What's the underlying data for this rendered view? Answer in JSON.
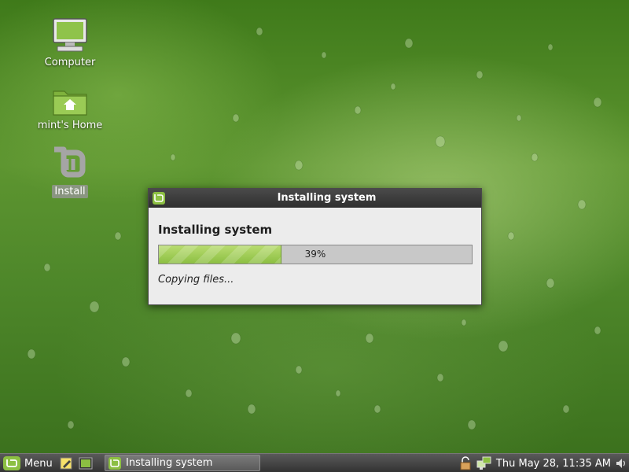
{
  "desktop": {
    "icons": [
      {
        "label": "Computer",
        "icon": "computer-icon"
      },
      {
        "label": "mint's Home",
        "icon": "home-folder-icon"
      },
      {
        "label": "Install",
        "icon": "mint-installer-icon"
      }
    ]
  },
  "dialog": {
    "title": "Installing system",
    "heading": "Installing system",
    "progress_percent": 39,
    "progress_label": "39%",
    "status": "Copying files..."
  },
  "taskbar": {
    "menu_label": "Menu",
    "task_label": "Installing system",
    "clock": "Thu May 28, 11:35 AM"
  },
  "colors": {
    "accent_green": "#8cbf42",
    "titlebar": "#3a3a3a",
    "dialog_bg": "#ececec"
  }
}
